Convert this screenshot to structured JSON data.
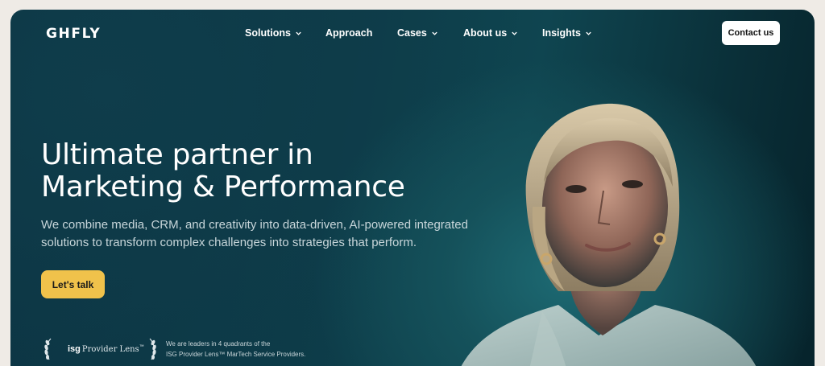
{
  "brand": {
    "logo_text": "GHFLY"
  },
  "nav": {
    "items": [
      {
        "label": "Solutions",
        "has_dropdown": true
      },
      {
        "label": "Approach",
        "has_dropdown": false
      },
      {
        "label": "Cases",
        "has_dropdown": true
      },
      {
        "label": "About us",
        "has_dropdown": true
      },
      {
        "label": "Insights",
        "has_dropdown": true
      }
    ],
    "contact_label": "Contact us"
  },
  "hero": {
    "headline_line1": "Ultimate partner in",
    "headline_line2": "Marketing & Performance",
    "subtext_line1": "We combine media, CRM, and creativity into data-driven, AI-powered integrated",
    "subtext_line2": "solutions to transform complex challenges into strategies that perform.",
    "cta_label": "Let's talk"
  },
  "badge": {
    "isg_mark": "isg",
    "isg_label": "Provider Lens",
    "tm": "™",
    "leaders_line1": "We are leaders in 4 quadrants of the",
    "leaders_line2": "ISG Provider Lens™ MarTech Service Providers."
  },
  "colors": {
    "page_background": "#efebe6",
    "hero_background": "#0d3b48",
    "cta_background": "#f0c24b",
    "text_primary": "#ffffff"
  },
  "icons": [
    "chevron-down-icon",
    "laurel-left-icon",
    "laurel-right-icon"
  ]
}
